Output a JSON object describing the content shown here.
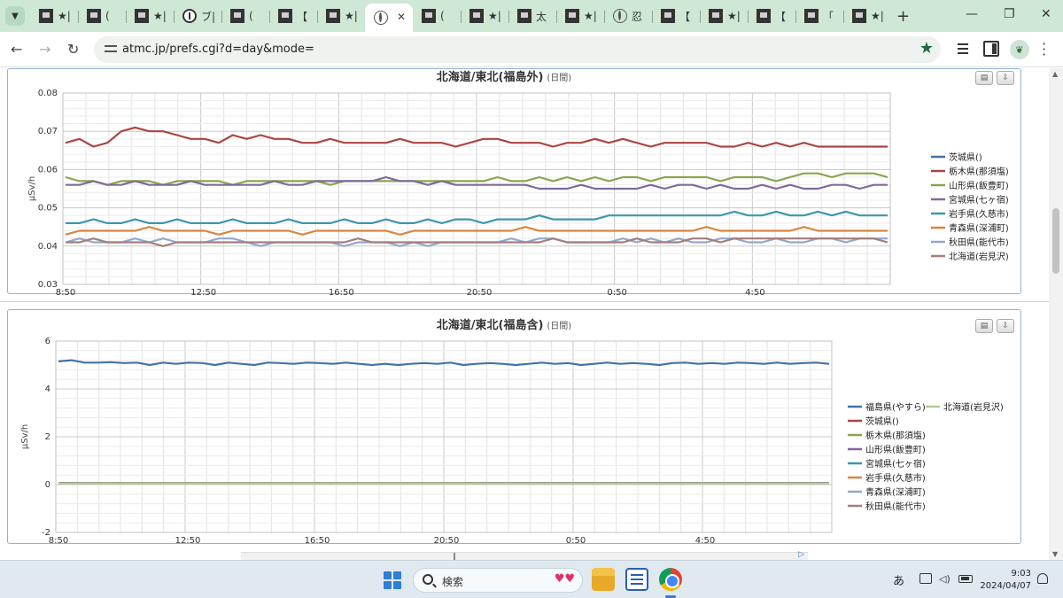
{
  "browser": {
    "tabs": [
      {
        "title": "★|",
        "icon": "site-favicon"
      },
      {
        "title": "(",
        "icon": "site-favicon"
      },
      {
        "title": "★|",
        "icon": "site-favicon"
      },
      {
        "title": "ブ|",
        "icon": "info-favicon"
      },
      {
        "title": "(",
        "icon": "site-favicon"
      },
      {
        "title": "【",
        "icon": "site-favicon"
      },
      {
        "title": "★|",
        "icon": "site-favicon"
      },
      {
        "title": "",
        "icon": "globe-favicon",
        "active": true
      },
      {
        "title": "(",
        "icon": "site-favicon"
      },
      {
        "title": "★|",
        "icon": "site-favicon"
      },
      {
        "title": "太",
        "icon": "site-favicon"
      },
      {
        "title": "★|",
        "icon": "site-favicon"
      },
      {
        "title": "忍",
        "icon": "globe-favicon"
      },
      {
        "title": "【",
        "icon": "site-favicon"
      },
      {
        "title": "★|",
        "icon": "site-favicon"
      },
      {
        "title": "【",
        "icon": "site-favicon"
      },
      {
        "title": "「",
        "icon": "site-favicon"
      },
      {
        "title": "★|",
        "icon": "site-favicon"
      }
    ],
    "url": "atmc.jp/prefs.cgi?d=day&mode="
  },
  "taskbar": {
    "search_placeholder": "検索",
    "ime": "あ",
    "time": "9:03",
    "date": "2024/04/07"
  },
  "colors": {
    "series": [
      "#4572a7",
      "#aa4643",
      "#89a54e",
      "#80699b",
      "#3d96ae",
      "#db843d",
      "#92a8cd",
      "#a47d7c",
      "#b5ca92"
    ],
    "panel_border": "#8fb2d8",
    "tab_strip": "#cfe8d6"
  },
  "chart_data": [
    {
      "type": "line",
      "title": "北海道/東北(福島外)",
      "subtitle": "(日間)",
      "ylabel": "μSv/h",
      "xlabel": "",
      "ylim": [
        0.03,
        0.08
      ],
      "yticks": [
        0.03,
        0.04,
        0.05,
        0.06,
        0.07,
        0.08
      ],
      "xticks": [
        "8:50",
        "12:50",
        "16:50",
        "20:50",
        "0:50",
        "4:50"
      ],
      "grid": true,
      "legend_position": "right",
      "series": [
        {
          "name": "茨城県()",
          "values": []
        },
        {
          "name": "栃木県(那須塩)",
          "values": [
            0.067,
            0.068,
            0.066,
            0.067,
            0.07,
            0.071,
            0.07,
            0.07,
            0.069,
            0.068,
            0.068,
            0.067,
            0.069,
            0.068,
            0.069,
            0.068,
            0.068,
            0.067,
            0.067,
            0.068,
            0.067,
            0.067,
            0.067,
            0.067,
            0.068,
            0.067,
            0.067,
            0.067,
            0.066,
            0.067,
            0.068,
            0.068,
            0.067,
            0.067,
            0.067,
            0.066,
            0.067,
            0.067,
            0.068,
            0.067,
            0.068,
            0.067,
            0.066,
            0.067,
            0.067,
            0.067,
            0.067,
            0.066,
            0.066,
            0.067,
            0.066,
            0.067,
            0.066,
            0.067,
            0.066,
            0.066,
            0.066,
            0.066,
            0.066,
            0.066
          ]
        },
        {
          "name": "山形県(飯豊町)",
          "values": [
            0.058,
            0.057,
            0.057,
            0.056,
            0.057,
            0.057,
            0.057,
            0.056,
            0.057,
            0.057,
            0.057,
            0.057,
            0.056,
            0.057,
            0.057,
            0.057,
            0.057,
            0.057,
            0.057,
            0.056,
            0.057,
            0.057,
            0.057,
            0.057,
            0.057,
            0.057,
            0.057,
            0.057,
            0.057,
            0.057,
            0.057,
            0.058,
            0.057,
            0.057,
            0.058,
            0.057,
            0.058,
            0.057,
            0.058,
            0.057,
            0.058,
            0.058,
            0.057,
            0.058,
            0.058,
            0.058,
            0.058,
            0.057,
            0.058,
            0.058,
            0.058,
            0.057,
            0.058,
            0.059,
            0.059,
            0.058,
            0.059,
            0.059,
            0.059,
            0.058
          ]
        },
        {
          "name": "宮城県(七ヶ宿)",
          "values": [
            0.056,
            0.056,
            0.057,
            0.056,
            0.056,
            0.057,
            0.056,
            0.056,
            0.056,
            0.057,
            0.056,
            0.056,
            0.056,
            0.056,
            0.056,
            0.057,
            0.056,
            0.056,
            0.057,
            0.057,
            0.057,
            0.057,
            0.057,
            0.058,
            0.057,
            0.057,
            0.056,
            0.057,
            0.056,
            0.056,
            0.056,
            0.056,
            0.056,
            0.056,
            0.055,
            0.055,
            0.055,
            0.056,
            0.055,
            0.055,
            0.055,
            0.055,
            0.056,
            0.055,
            0.056,
            0.056,
            0.055,
            0.056,
            0.055,
            0.055,
            0.056,
            0.055,
            0.056,
            0.055,
            0.055,
            0.056,
            0.056,
            0.055,
            0.056,
            0.056
          ]
        },
        {
          "name": "岩手県(久慈市)",
          "values": [
            0.046,
            0.046,
            0.047,
            0.046,
            0.046,
            0.047,
            0.046,
            0.046,
            0.047,
            0.046,
            0.046,
            0.046,
            0.047,
            0.046,
            0.046,
            0.046,
            0.047,
            0.046,
            0.046,
            0.046,
            0.047,
            0.046,
            0.046,
            0.047,
            0.046,
            0.046,
            0.047,
            0.046,
            0.047,
            0.047,
            0.046,
            0.047,
            0.047,
            0.047,
            0.048,
            0.047,
            0.047,
            0.047,
            0.047,
            0.048,
            0.048,
            0.048,
            0.048,
            0.048,
            0.048,
            0.048,
            0.048,
            0.048,
            0.049,
            0.048,
            0.048,
            0.049,
            0.048,
            0.048,
            0.049,
            0.048,
            0.049,
            0.048,
            0.048,
            0.048
          ]
        },
        {
          "name": "青森県(深浦町)",
          "values": [
            0.043,
            0.044,
            0.044,
            0.044,
            0.044,
            0.044,
            0.045,
            0.044,
            0.044,
            0.044,
            0.044,
            0.043,
            0.044,
            0.044,
            0.044,
            0.044,
            0.044,
            0.043,
            0.044,
            0.044,
            0.044,
            0.044,
            0.044,
            0.044,
            0.043,
            0.044,
            0.044,
            0.044,
            0.044,
            0.044,
            0.044,
            0.044,
            0.044,
            0.045,
            0.044,
            0.044,
            0.044,
            0.044,
            0.044,
            0.044,
            0.044,
            0.044,
            0.044,
            0.044,
            0.044,
            0.044,
            0.045,
            0.044,
            0.044,
            0.044,
            0.044,
            0.044,
            0.044,
            0.045,
            0.044,
            0.044,
            0.044,
            0.044,
            0.044,
            0.044
          ]
        },
        {
          "name": "秋田県(能代市)",
          "values": [
            0.041,
            0.042,
            0.041,
            0.041,
            0.041,
            0.042,
            0.041,
            0.042,
            0.041,
            0.041,
            0.041,
            0.042,
            0.042,
            0.041,
            0.04,
            0.041,
            0.041,
            0.041,
            0.041,
            0.041,
            0.04,
            0.041,
            0.041,
            0.041,
            0.04,
            0.041,
            0.04,
            0.041,
            0.041,
            0.041,
            0.041,
            0.041,
            0.042,
            0.041,
            0.042,
            0.042,
            0.041,
            0.041,
            0.041,
            0.041,
            0.042,
            0.041,
            0.042,
            0.041,
            0.042,
            0.041,
            0.041,
            0.042,
            0.042,
            0.041,
            0.041,
            0.042,
            0.041,
            0.041,
            0.042,
            0.042,
            0.041,
            0.042,
            0.042,
            0.042
          ]
        },
        {
          "name": "北海道(岩見沢)",
          "values": [
            0.041,
            0.041,
            0.042,
            0.041,
            0.041,
            0.041,
            0.041,
            0.04,
            0.041,
            0.041,
            0.041,
            0.041,
            0.041,
            0.041,
            0.041,
            0.041,
            0.041,
            0.041,
            0.041,
            0.041,
            0.041,
            0.042,
            0.041,
            0.041,
            0.041,
            0.041,
            0.041,
            0.041,
            0.041,
            0.041,
            0.041,
            0.041,
            0.041,
            0.041,
            0.041,
            0.042,
            0.041,
            0.041,
            0.041,
            0.041,
            0.041,
            0.042,
            0.041,
            0.041,
            0.041,
            0.042,
            0.042,
            0.041,
            0.042,
            0.042,
            0.042,
            0.042,
            0.042,
            0.042,
            0.042,
            0.042,
            0.042,
            0.042,
            0.042,
            0.041
          ]
        }
      ]
    },
    {
      "type": "line",
      "title": "北海道/東北(福島含)",
      "subtitle": "(日間)",
      "ylabel": "μSv/h",
      "xlabel": "",
      "ylim": [
        -2,
        6
      ],
      "yticks": [
        -2,
        0,
        2,
        4,
        6
      ],
      "xticks": [
        "8:50",
        "12:50",
        "16:50",
        "20:50",
        "0:50",
        "4:50"
      ],
      "grid": true,
      "legend_position": "right",
      "series": [
        {
          "name": "福島県(やすら)",
          "values": [
            5.15,
            5.2,
            5.1,
            5.1,
            5.12,
            5.08,
            5.1,
            5.0,
            5.1,
            5.05,
            5.1,
            5.08,
            5.0,
            5.1,
            5.05,
            5.0,
            5.1,
            5.08,
            5.05,
            5.1,
            5.08,
            5.05,
            5.1,
            5.05,
            5.0,
            5.05,
            5.0,
            5.05,
            5.08,
            5.05,
            5.1,
            5.0,
            5.05,
            5.08,
            5.05,
            5.0,
            5.05,
            5.1,
            5.05,
            5.08,
            5.0,
            5.05,
            5.1,
            5.05,
            5.08,
            5.05,
            5.0,
            5.08,
            5.1,
            5.05,
            5.08,
            5.05,
            5.1,
            5.08,
            5.05,
            5.1,
            5.05,
            5.08,
            5.1,
            5.05
          ]
        },
        {
          "name": "茨城県()",
          "values": []
        },
        {
          "name": "栃木県(那須塩)",
          "values": [
            0.067,
            0.068,
            0.067,
            0.067,
            0.066,
            0.067,
            0.067,
            0.066,
            0.067,
            0.066
          ]
        },
        {
          "name": "山形県(飯豊町)",
          "values": [
            0.058,
            0.057,
            0.057,
            0.057,
            0.057,
            0.058,
            0.058,
            0.058,
            0.059,
            0.058
          ]
        },
        {
          "name": "宮城県(七ヶ宿)",
          "values": [
            0.056,
            0.056,
            0.057,
            0.056,
            0.055,
            0.055,
            0.055,
            0.055,
            0.056,
            0.056
          ]
        },
        {
          "name": "岩手県(久慈市)",
          "values": [
            0.046,
            0.046,
            0.046,
            0.046,
            0.047,
            0.047,
            0.048,
            0.048,
            0.048,
            0.048
          ]
        },
        {
          "name": "青森県(深浦町)",
          "values": [
            0.044,
            0.044,
            0.044,
            0.044,
            0.044,
            0.044,
            0.044,
            0.044,
            0.044,
            0.044
          ]
        },
        {
          "name": "秋田県(能代市)",
          "values": [
            0.041,
            0.041,
            0.041,
            0.041,
            0.041,
            0.041,
            0.042,
            0.042,
            0.042,
            0.042
          ]
        },
        {
          "name": "北海道(岩見沢)",
          "values": [
            0.041,
            0.041,
            0.041,
            0.041,
            0.041,
            0.041,
            0.041,
            0.042,
            0.042,
            0.041
          ]
        }
      ]
    }
  ]
}
